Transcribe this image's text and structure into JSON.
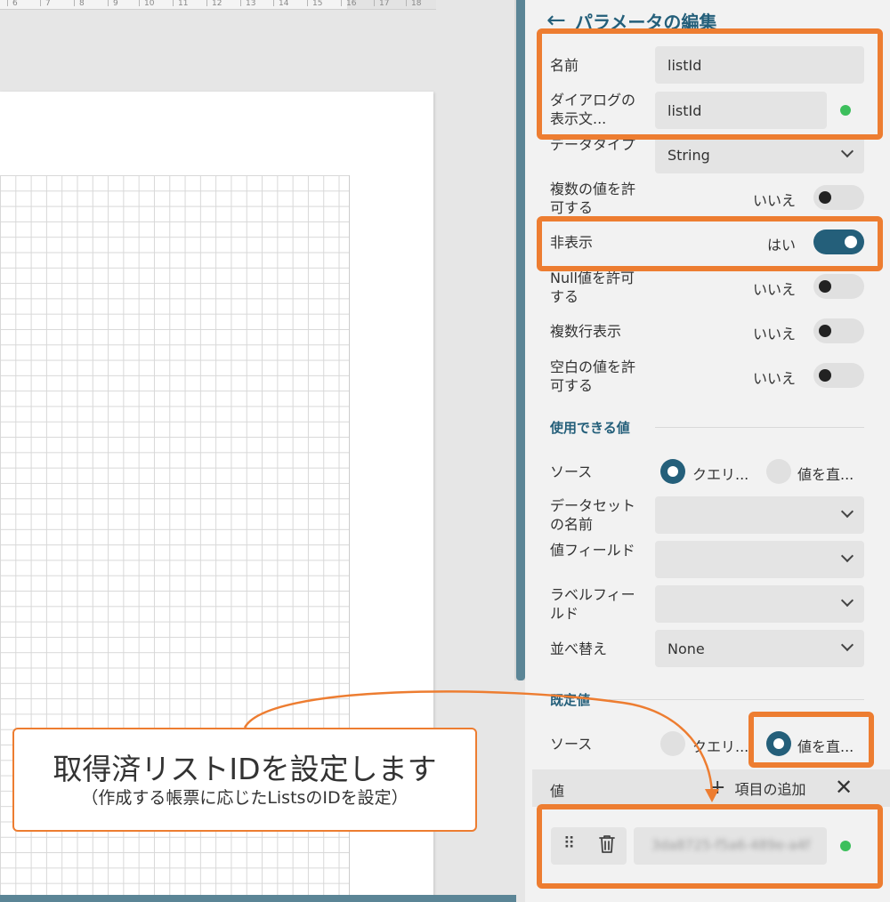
{
  "ruler": {
    "ticks": [
      "6",
      "7",
      "8",
      "9",
      "10",
      "11",
      "12",
      "13",
      "14",
      "15",
      "16",
      "17",
      "18"
    ]
  },
  "panel": {
    "title": "パラメータの編集",
    "back_icon": "arrow-left-icon",
    "fields": {
      "name_label": "名前",
      "name_value": "listId",
      "prompt_label": "ダイアログの表示文...",
      "prompt_value": "listId",
      "datatype_label": "データタイプ",
      "datatype_value": "String"
    },
    "toggles": {
      "multi_label": "複数の値を許可する",
      "multi_value": "いいえ",
      "hidden_label": "非表示",
      "hidden_value": "はい",
      "null_label": "Null値を許可する",
      "null_value": "いいえ",
      "multiline_label": "複数行表示",
      "multiline_value": "いいえ",
      "empty_label": "空白の値を許可する",
      "empty_value": "いいえ"
    },
    "available": {
      "section": "使用できる値",
      "source_label": "ソース",
      "opt_query": "クエリ...",
      "opt_direct": "値を直...",
      "dataset_label": "データセットの名前",
      "value_field_label": "値フィールド",
      "label_field_label": "ラベルフィールド",
      "sort_label": "並べ替え",
      "sort_value": "None"
    },
    "default": {
      "section": "既定値",
      "source_label": "ソース",
      "opt_query": "クエリ...",
      "opt_direct": "値を直...",
      "values_label": "値",
      "add_item": "項目の追加",
      "item_value": "3da8725-f5a6-489e-a4f"
    }
  },
  "callout": {
    "main": "取得済リストIDを設定します",
    "sub": "（作成する帳票に応じたListsのIDを設定）"
  },
  "colors": {
    "accent": "#245f7a",
    "highlight": "#ed7d31",
    "status_ok": "#3cbf5c"
  }
}
